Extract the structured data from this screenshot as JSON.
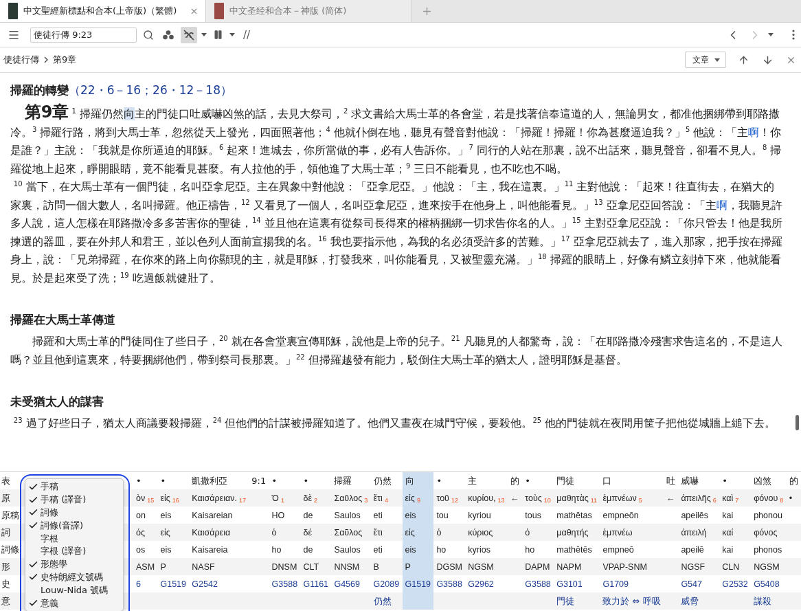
{
  "tabs": [
    {
      "title": "中文聖經新標點和合本(上帝版)（繁體)",
      "selected": true
    },
    {
      "title": "中文圣经和合本－神版 (简体)",
      "selected": false
    }
  ],
  "toolbar": {
    "reference": "使徒行傳 9:23",
    "separator_label": "//",
    "forward_disabled": true
  },
  "breadcrumb": {
    "book": "使徒行傳",
    "chapter": "第9章",
    "view": "文章"
  },
  "sections": [
    {
      "heading": "掃羅的轉變",
      "heading_ref": "（22・6－16；26・12－18）",
      "paragraphs": [
        {
          "chapter_label": "第9章",
          "indent": false,
          "segments": [
            {
              "kind": "plain",
              "text": "$^{1}$ 掃羅仍然"
            },
            {
              "kind": "selected",
              "text": "向"
            },
            {
              "kind": "plain",
              "text": "主的門徒口吐威嚇凶煞的話，去見大祭司，$^{2}$ 求文書給大馬士革的各會堂，若是找著信奉這道的人，無論男女，都准他捆綁帶到耶路撒冷。$^{3}$ 掃羅行路，將到大馬士革，忽然從天上發光，四面照著他；$^{4}$ 他就仆倒在地，聽見有聲音對他說：「掃羅！掃羅！你為甚麼逼迫我？」$^{5}$ 他說：「主"
            },
            {
              "kind": "link",
              "text": "啊"
            },
            {
              "kind": "plain",
              "text": "！你是誰？」主說：「我就是你所逼迫的耶穌。$^{6}$ 起來！進城去，你所當做的事，必有人告訴你。」$^{7}$ 同行的人站在那裏，說不出話來，聽見聲音，卻看不見人。$^{8}$ 掃羅從地上起來，睜開眼睛，竟不能看見甚麼。有人拉他的手，領他進了大馬士革；$^{9}$ 三日不能看見，也不吃也不喝。"
            }
          ]
        },
        {
          "indent": false,
          "segments": [
            {
              "kind": "plain",
              "text": "$^{10}$ 當下，在大馬士革有一個門徒，名叫亞拿尼亞。主在異象中對他說：「亞拿尼亞。」他說：「主，我在這裏。」$^{11}$ 主對他說：「起來！往直街去，在猶大的家裏，訪問一個大數人，名叫掃羅。他正禱告，$^{12}$ 又看見了一個人，名叫亞拿尼亞，進來按手在他身上，叫他能看見。」$^{13}$ 亞拿尼亞回答說：「主"
            },
            {
              "kind": "link",
              "text": "啊"
            },
            {
              "kind": "plain",
              "text": "，我聽見許多人說，這人怎樣在耶路撒冷多多苦害你的聖徒，$^{14}$ 並且他在這裏有從祭司長得來的權柄捆綁一切求告你名的人。」$^{15}$ 主對亞拿尼亞說：「你只管去！他是我所揀選的器皿，要在外邦人和君王，並以色列人面前宣揚我的名。$^{16}$ 我也要指示他，為我的名必須受許多的苦難。」$^{17}$ 亞拿尼亞就去了，進入那家，把手按在掃羅身上，說：「兄弟掃羅，在你來的路上向你顯現的主，就是耶穌，打發我來，叫你能看見，又被聖靈充滿。」$^{18}$ 掃羅的眼睛上，好像有鱗立刻掉下來，他就能看見。於是起來受了洗；$^{19}$ 吃過飯就健壯了。"
            }
          ]
        }
      ]
    },
    {
      "heading": "掃羅在大馬士革傳道",
      "paragraphs": [
        {
          "indent": true,
          "segments": [
            {
              "kind": "plain",
              "text": "掃羅和大馬士革的門徒同住了些日子，$^{20}$ 就在各會堂裏宣傳耶穌，說他是上帝的兒子。$^{21}$ 凡聽見的人都驚奇，說：「在耶路撒冷殘害求告這名的，不是這人嗎？並且他到這裏來，特要捆綁他們，帶到祭司長那裏。」$^{22}$ 但掃羅越發有能力，駁倒住大馬士革的猶太人，證明耶穌是基督。"
            }
          ]
        }
      ]
    },
    {
      "heading": "未受猶太人的謀害",
      "paragraphs": [
        {
          "indent": false,
          "segments": [
            {
              "kind": "plain",
              "text": "$^{23}$ 過了好些日子，猶太人商議要殺掃羅，$^{24}$ 但他們的計謀被掃羅知道了。他們又晝夜在城門守候，要殺他。$^{25}$ 他的門徒就在夜間用筐子把他從城牆上縋下去。"
            }
          ]
        }
      ]
    }
  ],
  "interlinear": {
    "row_labels": [
      "表",
      "原",
      "原稿",
      "詞",
      "詞條",
      "形",
      "史",
      "意"
    ],
    "columns": [
      {
        "surface": "•",
        "greek": "ὸν",
        "index": "15",
        "translit": "on",
        "lemma": "ός",
        "lemma_translit": "os",
        "morph": "ASM",
        "strong": "6",
        "selected": false
      },
      {
        "surface": "•",
        "greek": "εἰς",
        "index": "16",
        "translit": "eis",
        "lemma": "εἰς",
        "lemma_translit": "eis",
        "morph": "P",
        "strong": "G1519",
        "selected": false
      },
      {
        "surface": "凱撒利亞",
        "greek": "Καισάρειαν.",
        "index": "17",
        "translit": "Kaisareian",
        "lemma": "Καισάρεια",
        "lemma_translit": "Kaisareia",
        "morph": "NASF",
        "strong": "G2542",
        "selected": false
      },
      {
        "surface": "9:1",
        "selected": false
      },
      {
        "surface": "•",
        "greek": "Ὁ",
        "index": "1",
        "translit": "HO",
        "lemma": "ὁ",
        "lemma_translit": "ho",
        "morph": "DNSM",
        "strong": "G3588",
        "selected": false
      },
      {
        "surface": "•",
        "greek": "δὲ",
        "index": "2",
        "translit": "de",
        "lemma": "δέ",
        "lemma_translit": "de",
        "morph": "CLT",
        "strong": "G1161",
        "selected": false
      },
      {
        "surface": "掃羅",
        "greek": "Σαῦλος",
        "index": "3",
        "translit": "Saulos",
        "lemma": "Σαῦλος",
        "lemma_translit": "Saulos",
        "morph": "NNSM",
        "strong": "G4569",
        "selected": false
      },
      {
        "surface": "仍然",
        "greek": "ἔτι",
        "index": "4",
        "translit": "eti",
        "lemma": "ἔτι",
        "lemma_translit": "eti",
        "morph": "B",
        "strong": "G2089",
        "gloss": "仍然",
        "selected": false
      },
      {
        "surface": "向",
        "greek": "εἰς",
        "index": "9",
        "translit": "eis",
        "lemma": "εἰς",
        "lemma_translit": "eis",
        "morph": "P",
        "strong": "G1519",
        "selected": true
      },
      {
        "surface": "•",
        "greek": "τοῦ",
        "index": "12",
        "translit": "tou",
        "lemma": "ὁ",
        "lemma_translit": "ho",
        "morph": "DGSM",
        "strong": "G3588",
        "selected": false
      },
      {
        "surface": "主",
        "greek": "κυρίου,",
        "index": "13",
        "translit": "kyriou",
        "lemma": "κύριος",
        "lemma_translit": "kyrios",
        "morph": "NGSM",
        "strong": "G2962",
        "selected": false
      },
      {
        "surface": "的",
        "greek": "←",
        "selected": false
      },
      {
        "surface": "•",
        "greek": "τοὺς",
        "index": "10",
        "translit": "tous",
        "lemma": "ὁ",
        "lemma_translit": "ho",
        "morph": "DAPM",
        "strong": "G3588",
        "selected": false
      },
      {
        "surface": "門徒",
        "greek": "μαθητὰς",
        "index": "11",
        "translit": "mathētas",
        "lemma": "μαθητής",
        "lemma_translit": "mathētēs",
        "morph": "NAPM",
        "strong": "G3101",
        "gloss": "門徒",
        "selected": false
      },
      {
        "surface": "口",
        "greek": "ἐμπνέων",
        "index": "5",
        "translit": "empneōn",
        "lemma": "ἐμπνέω",
        "lemma_translit": "empneō",
        "morph": "VPAP-SNM",
        "strong": "G1709",
        "gloss": "致力於 ⇔ 呼吸",
        "selected": false
      },
      {
        "surface": "吐",
        "greek": "←",
        "selected": false
      },
      {
        "surface": "威嚇",
        "greek": "ἀπειλῆς",
        "index": "6",
        "translit": "apeilēs",
        "lemma": "ἀπειλή",
        "lemma_translit": "apeilē",
        "morph": "NGSF",
        "strong": "G547",
        "gloss": "威脅",
        "selected": false
      },
      {
        "surface": "•",
        "greek": "καὶ",
        "index": "7",
        "translit": "kai",
        "lemma": "καί",
        "lemma_translit": "kai",
        "morph": "CLN",
        "strong": "G2532",
        "selected": false
      },
      {
        "surface": "凶煞",
        "greek": "φόνου",
        "index": "8",
        "translit": "phonou",
        "lemma": "φόνος",
        "lemma_translit": "phonos",
        "morph": "NGSM",
        "strong": "G5408",
        "gloss": "謀殺",
        "selected": false
      },
      {
        "surface": "的",
        "greek": "•",
        "selected": false
      }
    ]
  },
  "row_menu": {
    "items": [
      {
        "label": "手稿",
        "checked": true
      },
      {
        "label": "手稿 (譯音)",
        "checked": true
      },
      {
        "label": "詞條",
        "checked": true
      },
      {
        "label": "詞條(音譯)",
        "checked": true
      },
      {
        "label": "字根",
        "checked": false
      },
      {
        "label": "字根 (譯音)",
        "checked": false
      },
      {
        "label": "形態學",
        "checked": true
      },
      {
        "label": "史特朗經文號碼",
        "checked": true
      },
      {
        "label": "Louw-Nida 號碼",
        "checked": false
      },
      {
        "label": "意義",
        "checked": true
      }
    ]
  }
}
